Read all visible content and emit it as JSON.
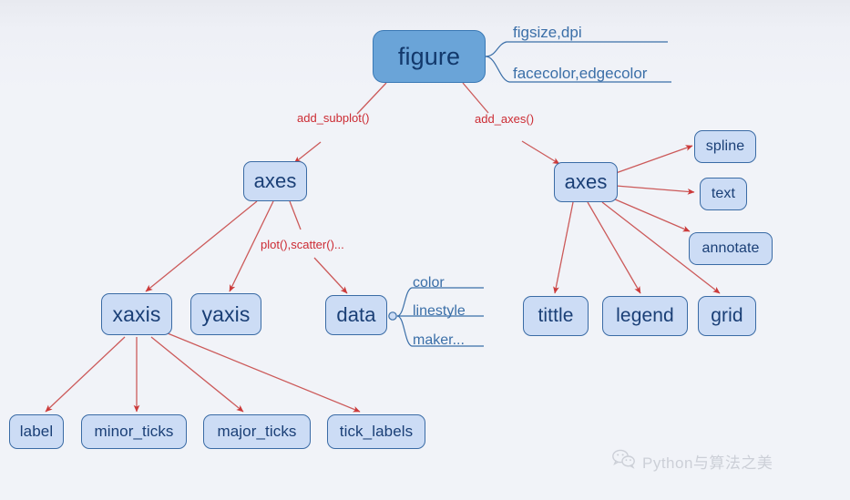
{
  "diagram": {
    "title": "Matplotlib object hierarchy mind map",
    "background_color": "#f1f3f8",
    "node_fill": "#ccdcf5",
    "node_border": "#3a6ba5",
    "node_text_color": "#1a3f76",
    "root_fill": "#6aa4d8",
    "arrow_color": "#cc3a3a",
    "edge_label_color": "#cc2b33",
    "branch_label_color": "#3b6fa8"
  },
  "nodes": {
    "figure": "figure",
    "axes_left": "axes",
    "axes_right": "axes",
    "xaxis": "xaxis",
    "yaxis": "yaxis",
    "data": "data",
    "label": "label",
    "minor_ticks": "minor_ticks",
    "major_ticks": "major_ticks",
    "tick_labels": "tick_labels",
    "spline": "spline",
    "text": "text",
    "annotate": "annotate",
    "tittle": "tittle",
    "legend": "legend",
    "grid": "grid"
  },
  "edge_labels": {
    "add_subplot": "add_subplot()",
    "add_axes": "add_axes()",
    "plot_scatter": "plot(),scatter()..."
  },
  "branch_labels": {
    "figsize_dpi": "figsize,dpi",
    "facecolor_edgecolor": "facecolor,edgecolor",
    "color": "color",
    "linestyle": "linestyle",
    "maker": "maker..."
  },
  "watermark": {
    "icon": "wechat-icon",
    "text": "Python与算法之美"
  }
}
